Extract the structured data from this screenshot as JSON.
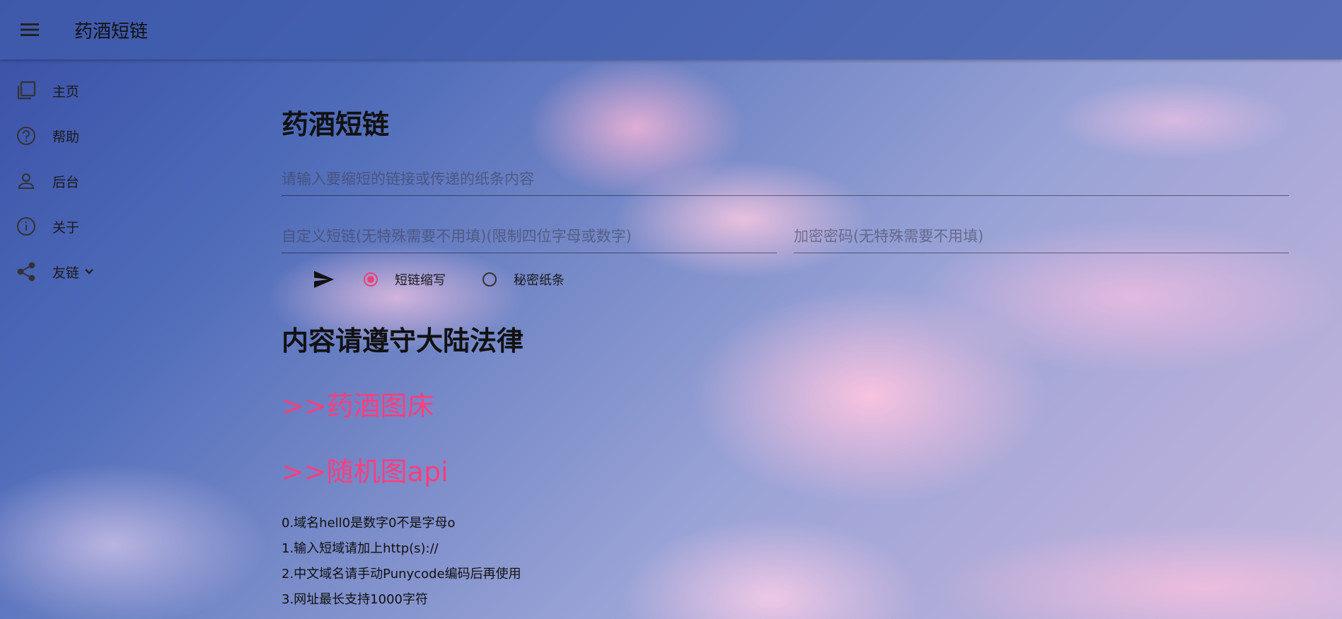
{
  "app": {
    "title": "药酒短链"
  },
  "nav": {
    "items": [
      {
        "label": "主页",
        "icon": "copy-icon"
      },
      {
        "label": "帮助",
        "icon": "help-icon"
      },
      {
        "label": "后台",
        "icon": "person-icon"
      },
      {
        "label": "关于",
        "icon": "info-icon"
      },
      {
        "label": "友链",
        "icon": "share-icon"
      }
    ]
  },
  "main": {
    "heading": "药酒短链",
    "url_input": {
      "placeholder": "请输入要缩短的链接或传递的纸条内容",
      "value": ""
    },
    "custom_input": {
      "placeholder": "自定义短链(无特殊需要不用填)(限制四位字母或数字)",
      "value": ""
    },
    "password_input": {
      "placeholder": "加密密码(无特殊需要不用填)",
      "value": ""
    },
    "modes": [
      {
        "label": "短链缩写",
        "selected": true
      },
      {
        "label": "秘密纸条",
        "selected": false
      }
    ],
    "law_notice": "内容请遵守大陆法律",
    "links": [
      {
        "label": ">>药酒图床"
      },
      {
        "label": ">>随机图api"
      }
    ],
    "notes": [
      "0.域名hell0是数字0不是字母o",
      "1.输入短域请加上http(s)://",
      "2.中文域名请手动Punycode编码后再使用",
      "3.网址最长支持1000字符"
    ]
  },
  "colors": {
    "accent": "#ff3d7f",
    "appbar": "#405cac",
    "radio_checked": "#e8407a"
  }
}
